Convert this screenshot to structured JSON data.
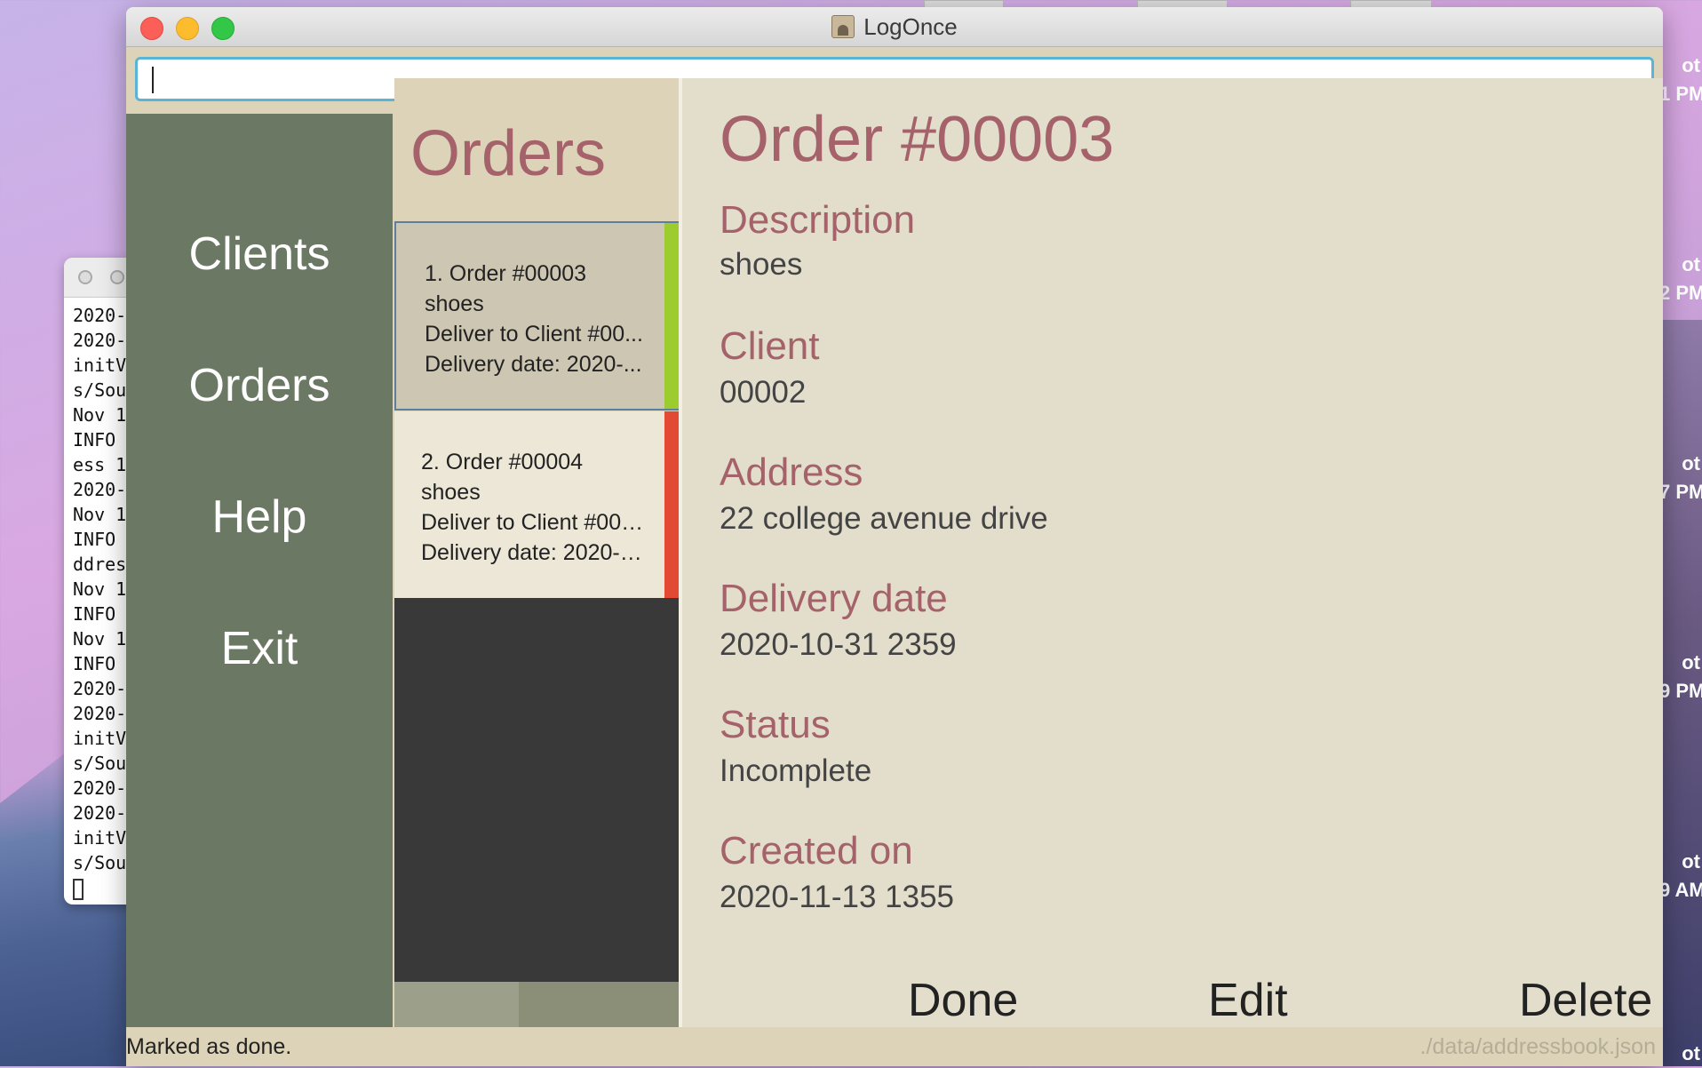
{
  "window": {
    "title": "LogOnce"
  },
  "command": {
    "value": "",
    "placeholder": ""
  },
  "sidebar": {
    "items": [
      {
        "label": "Clients"
      },
      {
        "label": "Orders"
      },
      {
        "label": "Help"
      },
      {
        "label": "Exit"
      }
    ]
  },
  "list": {
    "title": "Orders",
    "cards": [
      {
        "header": "1.  Order #00003",
        "description": "shoes",
        "deliver": "Deliver to Client #00...",
        "date": "Delivery date: 2020-...",
        "stripe_color": "#9ccc2e",
        "selected": true
      },
      {
        "header": "2.  Order #00004",
        "description": "shoes",
        "deliver": "Deliver to Client #000...",
        "date": "Delivery date: 2020-1...",
        "stripe_color": "#e24a33",
        "selected": false
      }
    ]
  },
  "detail": {
    "title": "Order #00003",
    "fields": [
      {
        "label": "Description",
        "value": "shoes"
      },
      {
        "label": "Client",
        "value": "00002"
      },
      {
        "label": "Address",
        "value": "22 college avenue drive"
      },
      {
        "label": "Delivery date",
        "value": "2020-10-31 2359"
      },
      {
        "label": "Status",
        "value": "Incomplete"
      },
      {
        "label": "Created on",
        "value": "2020-11-13 1355"
      }
    ],
    "actions": {
      "done": "Done",
      "edit": "Edit",
      "delete": "Delete"
    }
  },
  "status": {
    "message": "Marked as done.",
    "file_path": "./data/addressbook.json"
  },
  "terminal": {
    "lines": [
      "2020-",
      "2020-",
      "initV",
      "s/Sou",
      "Nov 1",
      "INFO ",
      "ess 1",
      "2020-",
      "Nov 1",
      "INFO ",
      "ddres",
      "Nov 1",
      "INFO ",
      "Nov 1",
      "INFO ",
      "2020-",
      "2020-",
      "initV",
      "s/Sou",
      "2020-",
      "2020-",
      "initV",
      "s/Sou"
    ]
  },
  "desktop": {
    "right_fragments": [
      "ot\n1 PM",
      "ot\n2 PM",
      "ot\n7 PM",
      "ot\n9 PM",
      "ot\n9 AM",
      "ot"
    ]
  },
  "colors": {
    "accent_text": "#a5626a",
    "sidebar_bg": "#6b7864",
    "panel_bg": "#dcd3b8",
    "detail_bg": "#e2decb",
    "focus_border": "#5ab4d6"
  }
}
